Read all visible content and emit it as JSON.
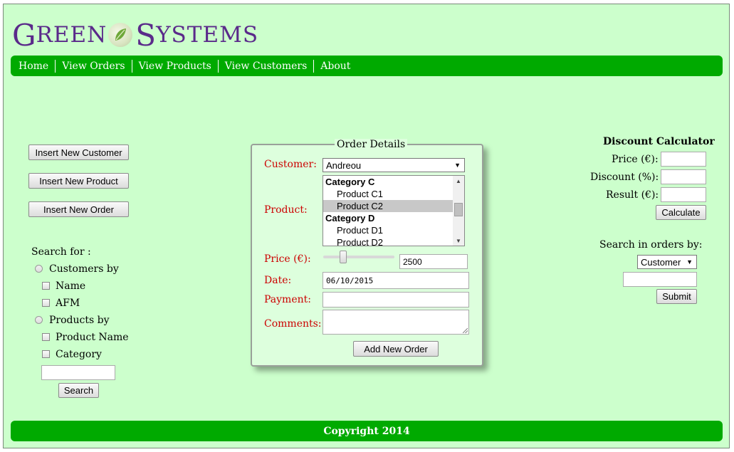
{
  "logo": {
    "first_initial": "G",
    "first_rest": "REEN",
    "second_initial": "S",
    "second_rest": "YSTEMS"
  },
  "nav": {
    "items": [
      "Home",
      "View Orders",
      "View Products",
      "View Customers",
      "About"
    ]
  },
  "left_buttons": {
    "insert_customer": "Insert New Customer",
    "insert_product": "Insert New Product",
    "insert_order": "Insert New Order"
  },
  "search": {
    "title": "Search for :",
    "customers_by": "Customers by",
    "name": "Name",
    "afm": "AFM",
    "products_by": "Products by",
    "product_name": "Product Name",
    "category": "Category",
    "input_value": "",
    "button": "Search"
  },
  "order": {
    "legend": "Order Details",
    "customer_label": "Customer:",
    "customer_value": "Andreou",
    "product_label": "Product:",
    "product_list": [
      {
        "text": "Category C",
        "kind": "group"
      },
      {
        "text": "Product C1",
        "kind": "opt"
      },
      {
        "text": "Product C2",
        "kind": "opt",
        "selected": true
      },
      {
        "text": "Category D",
        "kind": "group"
      },
      {
        "text": "Product D1",
        "kind": "opt"
      },
      {
        "text": "Product D2",
        "kind": "opt"
      }
    ],
    "price_label": "Price (€):",
    "price_value": "2500",
    "date_label": "Date:",
    "date_value": "06/10/2015",
    "payment_label": "Payment:",
    "payment_value": "",
    "comments_label": "Comments:",
    "comments_value": "",
    "submit": "Add New Order"
  },
  "discount": {
    "title": "Discount Calculator",
    "price_label": "Price (€):",
    "discount_label": "Discount (%):",
    "result_label": "Result (€):",
    "button": "Calculate"
  },
  "order_search": {
    "label": "Search in orders by:",
    "select_value": "Customer",
    "input_value": "",
    "button": "Submit"
  },
  "footer": {
    "text": "Copyright 2014"
  },
  "colors": {
    "page_bg": "#ccffcc",
    "bar_green": "#00aa00",
    "logo_purple": "#5a2a8a",
    "field_label_red": "#cc0000"
  }
}
